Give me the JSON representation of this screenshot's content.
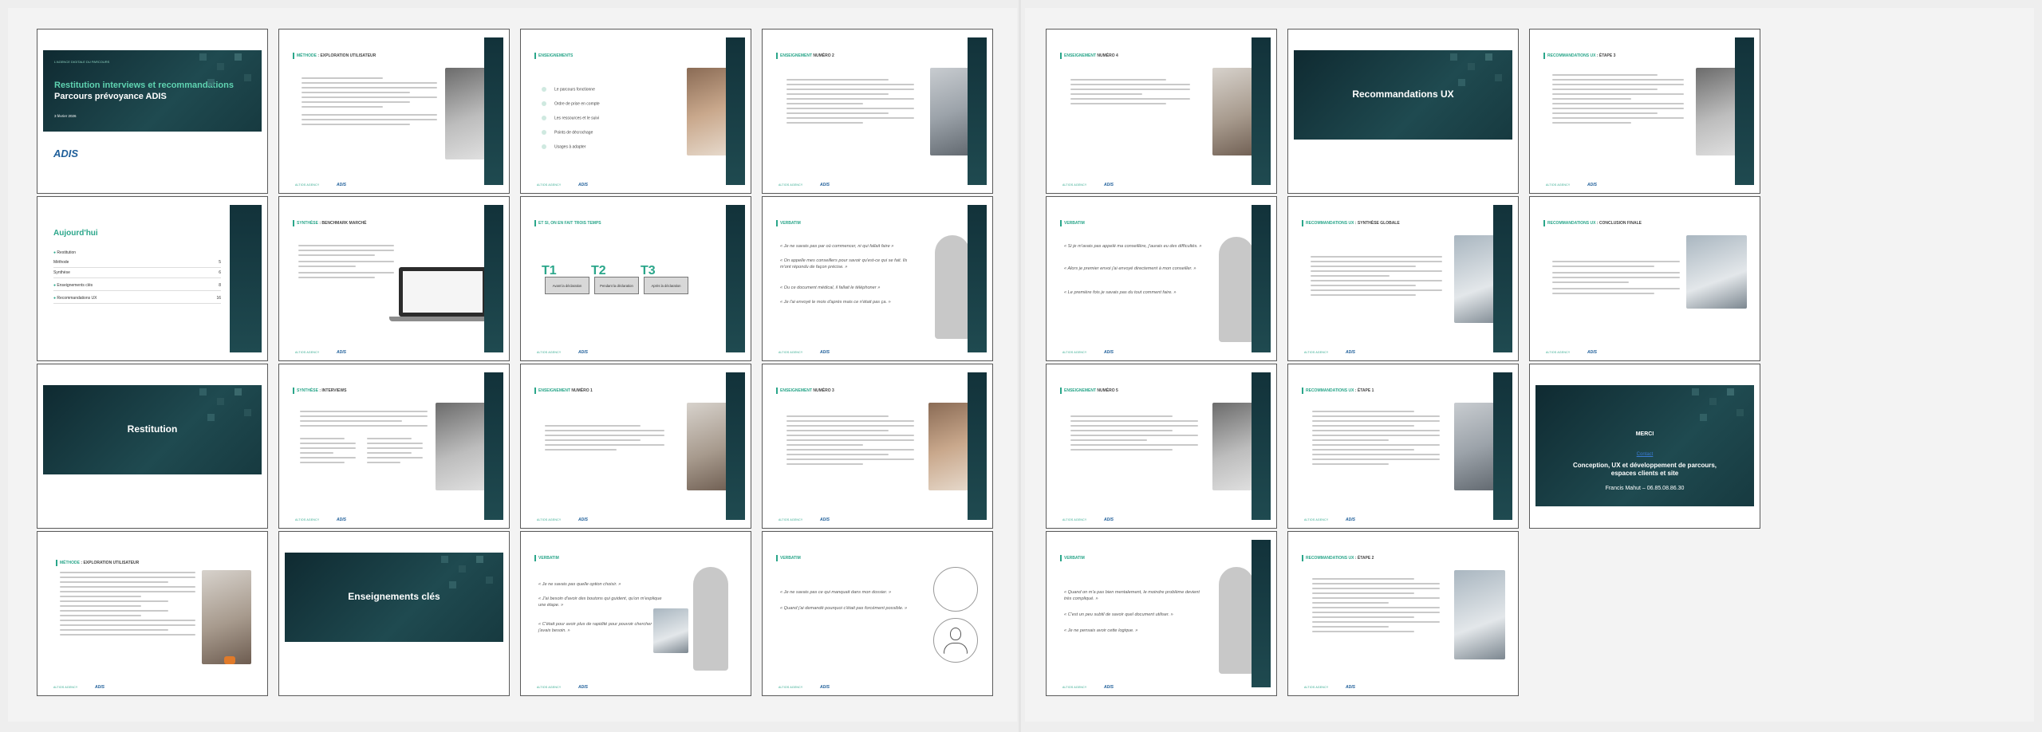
{
  "slides": {
    "s01": {
      "tagline": "L'AGENCE DIGITALE DU PARCOURS",
      "title_1": "Restitution interviews et recommandations",
      "title_2": "Parcours prévoyance ADIS",
      "date": "3 février 2026",
      "logo": "ADIS"
    },
    "s02": {
      "title_acc": "MÉTHODE",
      "title": " : EXPLORATION UTILISATEUR"
    },
    "s03": {
      "title_acc": "ENSEIGNEMENTS",
      "items": [
        "Le parcours fonctionne",
        "Ordre de prise en compte",
        "Les ressources et le suivi",
        "Points de décrochage",
        "Usages à adapter"
      ]
    },
    "s04": {
      "title_acc": "ENSEIGNEMENT",
      "title": " NUMÉRO 2"
    },
    "s05": {
      "title": "Aujourd'hui",
      "items": [
        {
          "label": "Restitution",
          "page": ""
        },
        {
          "label": "Méthode",
          "page": "5"
        },
        {
          "label": "Synthèse",
          "page": "6"
        },
        {
          "label": "Enseignements clés",
          "page": "8"
        },
        {
          "label": "Recommandations UX",
          "page": "16"
        }
      ]
    },
    "s06": {
      "title_acc": "SYNTHÈSE",
      "title": " : BENCHMARK MARCHÉ"
    },
    "s07": {
      "title": "ET SI, ON EN FAIT TROIS TEMPS",
      "steps": [
        {
          "label": "T1",
          "box": "Avant la déclaration"
        },
        {
          "label": "T2",
          "box": "Pendant la déclaration"
        },
        {
          "label": "T3",
          "box": "Après la déclaration"
        }
      ]
    },
    "s08": {
      "title": "VERBATIM",
      "quotes": [
        "« Je ne savais pas par où commencer, ni qui fallait faire »",
        "« On appelle mes conseillers pour savoir qu'est-ce qui se fait. Ils m'ont répondu de façon précise. »",
        "« Ou ce document médical, il fallait le téléphoner »",
        "« Je l'ai envoyé le mois d'après mais ce n'était pas ça. »"
      ]
    },
    "s09": {
      "title": "Restitution"
    },
    "s10": {
      "title_acc": "SYNTHÈSE",
      "title": " : INTERVIEWS"
    },
    "s11": {
      "title_acc": "ENSEIGNEMENT",
      "title": " NUMÉRO 1"
    },
    "s12": {
      "title_acc": "ENSEIGNEMENT",
      "title": " NUMÉRO 3"
    },
    "s13": {
      "title_acc": "MÉTHODE",
      "title": " : EXPLORATION UTILISATEUR"
    },
    "s14": {
      "title": "Enseignements clés"
    },
    "s15": {
      "title": "VERBATIM",
      "quotes": [
        "« Je ne savais pas quelle option choisir. »",
        "« J'ai besoin d'avoir des boutons qui guident, qu'on m'explique une étape. »",
        "« C'était pour avoir plus de rapidité pour pouvoir chercher ce dont j'avais besoin. »"
      ]
    },
    "s16": {
      "title": "VERBATIM",
      "quotes": [
        "« Je ne savais pas ce qui manquait dans mon dossier. »",
        "« Quand j'ai demandé pourquoi c'était pas forcément possible. »"
      ]
    },
    "s17": {
      "title_acc": "ENSEIGNEMENT",
      "title": " NUMÉRO 4"
    },
    "s18": {
      "title": "Recommandations UX"
    },
    "s19": {
      "title_acc": "RECOMMANDATIONS UX",
      "title": " : ÉTAPE 3"
    },
    "s20": {
      "title": "VERBATIM",
      "quotes": [
        "« Si je m'avais pas appelé ma conseillère, j'aurais eu des difficultés. »",
        "« Alors je premier envoi j'ai envoyé directement à mon conseiller. »",
        "« Le première fois je savais pas du tout comment faire. »"
      ]
    },
    "s21": {
      "title_acc": "RECOMMANDATIONS UX",
      "title": " : SYNTHÈSE GLOBALE"
    },
    "s22": {
      "title_acc": "RECOMMANDATIONS UX",
      "title": " : CONCLUSION FINALE"
    },
    "s23": {
      "title_acc": "ENSEIGNEMENT",
      "title": " NUMÉRO 5"
    },
    "s24": {
      "title_acc": "RECOMMANDATIONS UX",
      "title": " : ÉTAPE 1"
    },
    "s25": {
      "thanks": "MERCI",
      "link": "Contact",
      "subtitle": "Conception, UX et développement de parcours, espaces clients et site",
      "contact": "Francis Mahut – 06.85.08.86.30"
    },
    "s26": {
      "title": "VERBATIM",
      "quotes": [
        "« Quand on m'a pas bien mentalement, le moindre problème devient très compliqué. »",
        "« C'est un peu subtil de savoir quel document utiliser. »",
        "« Je ne pensais avoir cette logique. »"
      ]
    },
    "s27": {
      "title_acc": "RECOMMANDATIONS UX",
      "title": " : ÉTAPE 2"
    }
  },
  "footer": {
    "brand": "ALTIOS AGENCY",
    "logo": "ADIS"
  },
  "colors": {
    "teal_dark": "#0f2a31",
    "accent": "#2aa68a",
    "logo_blue": "#1f5f9a"
  }
}
